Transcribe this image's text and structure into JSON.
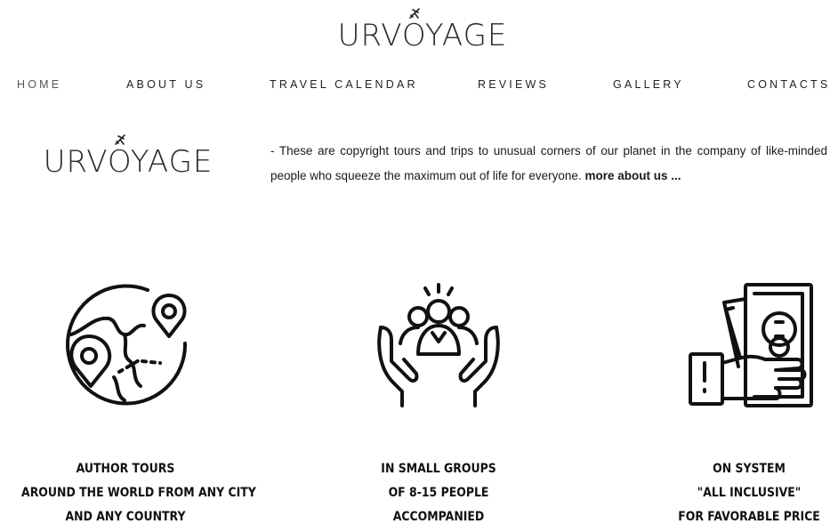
{
  "brand": {
    "name": "URVOYAGE"
  },
  "nav": {
    "items": [
      {
        "label": "HOME"
      },
      {
        "label": "ABOUT US"
      },
      {
        "label": "TRAVEL CALENDAR"
      },
      {
        "label": "REVIEWS"
      },
      {
        "label": "GALLERY"
      },
      {
        "label": "CONTACTS"
      }
    ]
  },
  "intro": {
    "text": "- These are copyright tours and trips to unusual corners of our planet in the company of like-minded people who squeeze the maximum out of life for everyone.",
    "more_link": "more about us ..."
  },
  "features": [
    {
      "icon": "globe-map-pins-icon",
      "lines": [
        "AUTHOR TOURS",
        "AROUND THE WORLD  FROM ANY  CITY",
        "AND ANY COUNTRY"
      ]
    },
    {
      "icon": "hands-holding-group-icon",
      "lines": [
        "IN SMALL GROUPS",
        "OF 8-15 PEOPLE",
        "ACCOMPANIED"
      ]
    },
    {
      "icon": "hand-with-money-icon",
      "lines": [
        "ON SYSTEM",
        "\"ALL INCLUSIVE\"",
        "FOR FAVORABLE PRICE"
      ]
    }
  ]
}
